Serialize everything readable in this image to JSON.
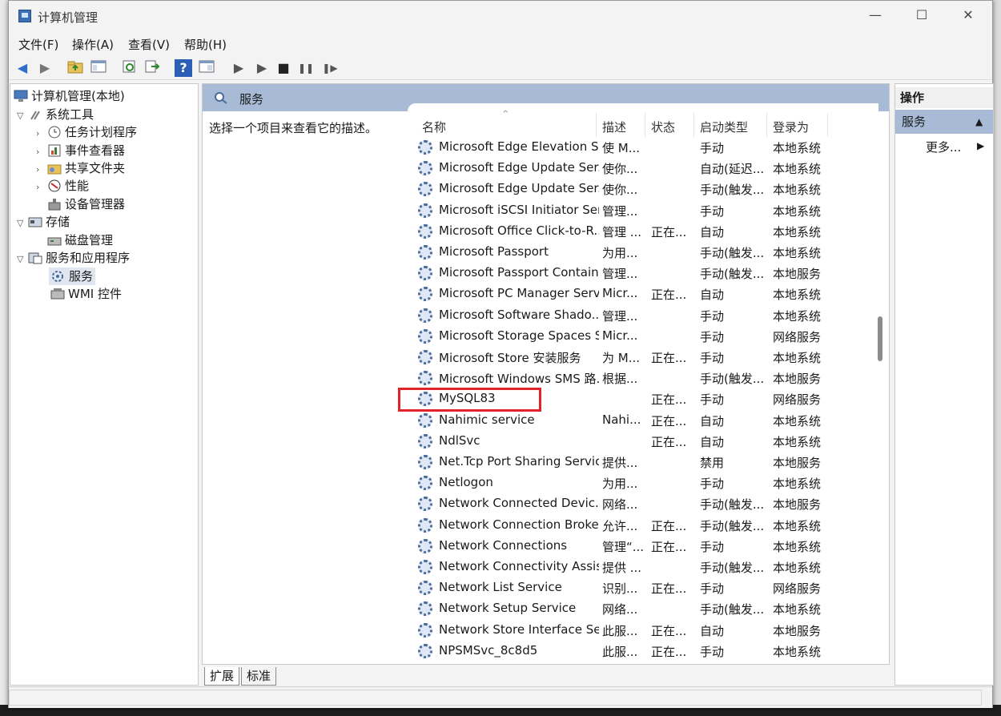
{
  "window": {
    "title": "计算机管理",
    "minimize": "—",
    "maximize": "☐",
    "close": "✕"
  },
  "menu": [
    "文件(F)",
    "操作(A)",
    "查看(V)",
    "帮助(H)"
  ],
  "toolbar": {
    "back": "◀",
    "forward": "▶",
    "help": "?",
    "start": "▶",
    "start2": "▶",
    "stop": "■",
    "pause": "❚❚",
    "resume": "❚▶"
  },
  "tree": {
    "root": "计算机管理(本地)",
    "system_tools": "系统工具",
    "task_scheduler": "任务计划程序",
    "event_viewer": "事件查看器",
    "shared_folders": "共享文件夹",
    "performance": "性能",
    "device_manager": "设备管理器",
    "storage": "存储",
    "disk_management": "磁盘管理",
    "services_apps": "服务和应用程序",
    "services": "服务",
    "wmi": "WMI 控件"
  },
  "center": {
    "header": "服务",
    "description": "选择一个项目来查看它的描述。",
    "columns": {
      "name": "名称",
      "desc": "描述",
      "status": "状态",
      "startup": "启动类型",
      "logon": "登录为"
    },
    "sort_indicator": "^",
    "rows": [
      {
        "name": "Microsoft Edge Elevation S...",
        "desc": "使 M...",
        "status": "",
        "startup": "手动",
        "logon": "本地系统"
      },
      {
        "name": "Microsoft Edge Update Ser...",
        "desc": "使你...",
        "status": "",
        "startup": "自动(延迟...",
        "logon": "本地系统"
      },
      {
        "name": "Microsoft Edge Update Ser...",
        "desc": "使你...",
        "status": "",
        "startup": "手动(触发...",
        "logon": "本地系统"
      },
      {
        "name": "Microsoft iSCSI Initiator Ser...",
        "desc": "管理...",
        "status": "",
        "startup": "手动",
        "logon": "本地系统"
      },
      {
        "name": "Microsoft Office Click-to-R...",
        "desc": "管理 ...",
        "status": "正在...",
        "startup": "自动",
        "logon": "本地系统"
      },
      {
        "name": "Microsoft Passport",
        "desc": "为用...",
        "status": "",
        "startup": "手动(触发...",
        "logon": "本地系统"
      },
      {
        "name": "Microsoft Passport Container",
        "desc": "管理...",
        "status": "",
        "startup": "手动(触发...",
        "logon": "本地服务"
      },
      {
        "name": "Microsoft PC Manager Serv...",
        "desc": "Micr...",
        "status": "正在...",
        "startup": "自动",
        "logon": "本地系统"
      },
      {
        "name": "Microsoft Software Shado...",
        "desc": "管理...",
        "status": "",
        "startup": "手动",
        "logon": "本地系统"
      },
      {
        "name": "Microsoft Storage Spaces S...",
        "desc": "Micr...",
        "status": "",
        "startup": "手动",
        "logon": "网络服务"
      },
      {
        "name": "Microsoft Store 安装服务",
        "desc": "为 M...",
        "status": "正在...",
        "startup": "手动",
        "logon": "本地系统"
      },
      {
        "name": "Microsoft Windows SMS 路...",
        "desc": "根据...",
        "status": "",
        "startup": "手动(触发...",
        "logon": "本地服务"
      },
      {
        "name": "MySQL83",
        "desc": "",
        "status": "正在...",
        "startup": "手动",
        "logon": "网络服务"
      },
      {
        "name": "Nahimic service",
        "desc": "Nahi...",
        "status": "正在...",
        "startup": "自动",
        "logon": "本地系统"
      },
      {
        "name": "NdlSvc",
        "desc": "",
        "status": "正在...",
        "startup": "自动",
        "logon": "本地系统"
      },
      {
        "name": "Net.Tcp Port Sharing Service",
        "desc": "提供...",
        "status": "",
        "startup": "禁用",
        "logon": "本地服务"
      },
      {
        "name": "Netlogon",
        "desc": "为用...",
        "status": "",
        "startup": "手动",
        "logon": "本地系统"
      },
      {
        "name": "Network Connected Devic...",
        "desc": "网络...",
        "status": "",
        "startup": "手动(触发...",
        "logon": "本地服务"
      },
      {
        "name": "Network Connection Broker",
        "desc": "允许...",
        "status": "正在...",
        "startup": "手动(触发...",
        "logon": "本地系统"
      },
      {
        "name": "Network Connections",
        "desc": "管理“...",
        "status": "正在...",
        "startup": "手动",
        "logon": "本地系统"
      },
      {
        "name": "Network Connectivity Assis...",
        "desc": "提供 ...",
        "status": "",
        "startup": "手动(触发...",
        "logon": "本地系统"
      },
      {
        "name": "Network List Service",
        "desc": "识别...",
        "status": "正在...",
        "startup": "手动",
        "logon": "网络服务"
      },
      {
        "name": "Network Setup Service",
        "desc": "网络...",
        "status": "",
        "startup": "手动(触发...",
        "logon": "本地系统"
      },
      {
        "name": "Network Store Interface Se...",
        "desc": "此服...",
        "status": "正在...",
        "startup": "自动",
        "logon": "本地服务"
      },
      {
        "name": "NPSMSvc_8c8d5",
        "desc": "此服...",
        "status": "正在...",
        "startup": "手动",
        "logon": "本地系统"
      }
    ]
  },
  "tabs": [
    "扩展",
    "标准"
  ],
  "actions": {
    "header": "操作",
    "services": "服务",
    "services_arrow": "▲",
    "more": "更多...",
    "more_arrow": "▶"
  },
  "colors": {
    "header_bg": "#a7bbd6",
    "highlight": "#e3232a"
  }
}
